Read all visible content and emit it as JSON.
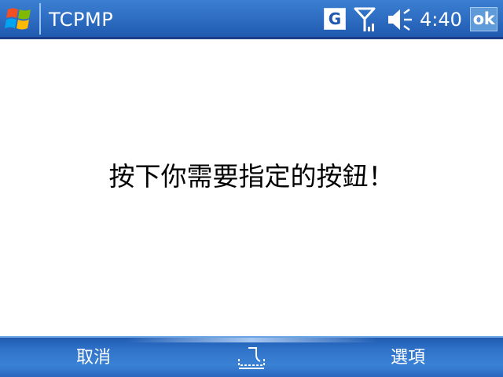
{
  "titlebar": {
    "app_title": "TCPMP",
    "start_icon": "windows-flag-icon",
    "status_icons": [
      "g-network-icon",
      "signal-icon",
      "volume-muted-icon"
    ],
    "clock": "4:40",
    "ok_label": "ok"
  },
  "content": {
    "prompt": "按下你需要指定的按鈕！"
  },
  "menubar": {
    "left_softkey": "取消",
    "center_icon": "input-panel-icon",
    "right_softkey": "選項"
  },
  "colors": {
    "bar_blue": "#2f6fc4",
    "text_white": "#ffffff",
    "content_bg": "#ffffff"
  }
}
